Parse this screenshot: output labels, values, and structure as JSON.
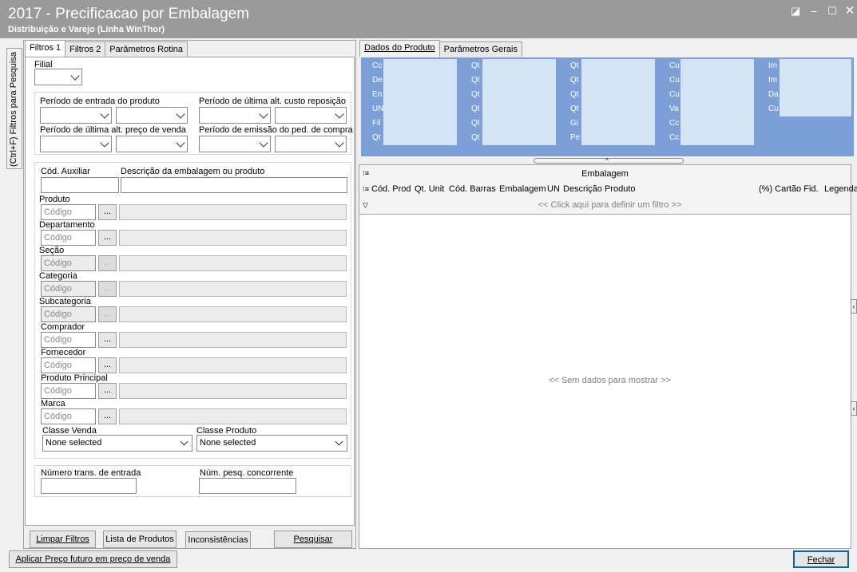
{
  "window": {
    "title": "2017 - Precificacao por Embalagem",
    "subtitle": "Distribuição e Varejo (Linha WinThor)"
  },
  "sidebar_tab": "(Ctrl+F) Filtros para Pesquisa",
  "left_tabs": [
    "Filtros 1",
    "Filtros 2",
    "Parâmetros Rotina"
  ],
  "filters": {
    "filial_label": "Filial",
    "periodo_entrada": "Período de entrada do produto",
    "periodo_ult_custo": "Período de última alt. custo reposição",
    "periodo_ult_preco": "Período de última alt. preço de venda",
    "periodo_emissao": "Período de emissão do ped. de compra",
    "cod_aux": "Cód. Auxiliar",
    "desc_emb": "Descrição da embalagem ou produto",
    "placeholder": "Código",
    "dots": "...",
    "rows": [
      {
        "label": "Produto",
        "enabled": true
      },
      {
        "label": "Departamento",
        "enabled": true
      },
      {
        "label": "Seção",
        "enabled": false
      },
      {
        "label": "Categoria",
        "enabled": false
      },
      {
        "label": "Subcategoria",
        "enabled": false
      },
      {
        "label": "Comprador",
        "enabled": true
      },
      {
        "label": "Fornecedor",
        "enabled": true
      },
      {
        "label": "Produto Principal",
        "enabled": true
      },
      {
        "label": "Marca",
        "enabled": true
      }
    ],
    "classe_venda": "Classe Venda",
    "classe_produto": "Classe Produto",
    "classe_venda_value": "None selected",
    "classe_produto_value": "None selected",
    "num_trans": "Número trans. de entrada",
    "num_pesq": "Núm. pesq. concorrente"
  },
  "buttons": {
    "limpar": "Limpar Filtros",
    "lista": "Lista de Produtos",
    "inconsistencias": "Inconsistências",
    "pesquisar": "Pesquisar",
    "aplicar": "Aplicar Preço futuro em preço de venda",
    "fechar": "Fechar"
  },
  "right_tabs": [
    "Dados do Produto",
    "Parâmetros Gerais"
  ],
  "cards": [
    [
      "Cc",
      "De",
      "En",
      "UN",
      "Fil",
      "Qt"
    ],
    [
      "Qt",
      "Qt",
      "Qt",
      "Qt",
      "Qt",
      "Qt"
    ],
    [
      "Qt",
      "Qt",
      "Qt",
      "Qt",
      "Gi",
      "Pe"
    ],
    [
      "Cu",
      "Cu",
      "Cu",
      "Va",
      "Cc",
      "Cc"
    ],
    [
      "Im",
      "Im",
      "Da",
      "Cu"
    ]
  ],
  "grid": {
    "group": "Embalagem",
    "columns": [
      "Cód. Prod",
      "Qt. Unit",
      "Cód. Barras",
      "Embalagem",
      "UN",
      "Descrição Produto",
      "(%) Cartão Fid.",
      "Legenda"
    ],
    "filter_hint": "<< Click aqui para definir um filtro >>",
    "empty": "<< Sem dados para mostrar >>"
  },
  "colors": {
    "titlebar": "#9a9a9a",
    "cards_bg": "#7d9fd8",
    "card_value": "#d4e4f6",
    "accent_border": "#0a64b4"
  }
}
